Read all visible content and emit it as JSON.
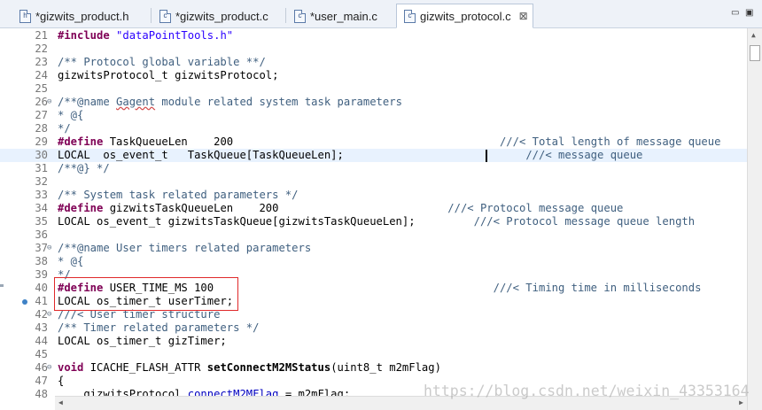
{
  "tabs": [
    {
      "label": "*gizwits_product.h",
      "icon": "h"
    },
    {
      "label": "*gizwits_product.c",
      "icon": "c"
    },
    {
      "label": "*user_main.c",
      "icon": "c"
    },
    {
      "label": "gizwits_protocol.c",
      "icon": "c",
      "close": "⊠"
    }
  ],
  "window_controls": {
    "minimize": "▭",
    "maximize": "▣"
  },
  "editor": {
    "lines": [
      {
        "n": "21",
        "html": "<span class=\"kw\">#include</span> <span class=\"st\">\"dataPointTools.h\"</span>"
      },
      {
        "n": "22",
        "html": ""
      },
      {
        "n": "23",
        "html": "<span class=\"cm\">/** Protocol global variable **/</span>"
      },
      {
        "n": "24",
        "html": "gizwitsProtocol_t gizwitsProtocol;"
      },
      {
        "n": "25",
        "html": ""
      },
      {
        "n": "26",
        "fold": true,
        "html": "<span class=\"cm\">/**@name <span style=\"text-decoration:underline wavy #d34b4b\">Gagent</span> module related system task parameters</span>"
      },
      {
        "n": "27",
        "html": "<span class=\"cm\">* @{</span>"
      },
      {
        "n": "28",
        "html": "<span class=\"cm\">*/</span>"
      },
      {
        "n": "29",
        "html": "<span class=\"kw\">#define</span> TaskQueueLen    200                                         <span class=\"cm\">///&lt; Total length of message queue</span>"
      },
      {
        "n": "30",
        "current": true,
        "html": "LOCAL  os_event_t   TaskQueue[TaskQueueLen];                            <span class=\"cm\">///&lt; message queue</span>"
      },
      {
        "n": "31",
        "html": "<span class=\"cm\">/**@} */</span>"
      },
      {
        "n": "32",
        "html": ""
      },
      {
        "n": "33",
        "html": "<span class=\"cm\">/** System task related parameters */</span>"
      },
      {
        "n": "34",
        "html": "<span class=\"kw\">#define</span> gizwitsTaskQueueLen    200                          <span class=\"cm\">///&lt; Protocol message queue</span>"
      },
      {
        "n": "35",
        "html": "LOCAL os_event_t gizwitsTaskQueue[gizwitsTaskQueueLen];         <span class=\"cm\">///&lt; Protocol message queue length</span>"
      },
      {
        "n": "36",
        "html": ""
      },
      {
        "n": "37",
        "fold": true,
        "html": "<span class=\"cm\">/**@name User timers related parameters</span>"
      },
      {
        "n": "38",
        "html": "<span class=\"cm\">* @{</span>"
      },
      {
        "n": "39",
        "html": "<span class=\"cm\">*/</span>"
      },
      {
        "n": "40",
        "html": "<span class=\"kw\">#define</span> USER_TIME_MS 100                                           <span class=\"cm\">///&lt; Timing time in milliseconds</span>"
      },
      {
        "n": "41",
        "bp": true,
        "html": "LOCAL os_timer_t userTimer;"
      },
      {
        "n": "42",
        "fold": true,
        "html": "<span class=\"cm\">///&lt; User timer structure</span>"
      },
      {
        "n": "43",
        "html": "<span class=\"cm\">/** Timer related parameters */</span>"
      },
      {
        "n": "44",
        "html": "LOCAL os_timer_t gizTimer;"
      },
      {
        "n": "45",
        "html": ""
      },
      {
        "n": "46",
        "fold": true,
        "html": "<span class=\"kw\">void</span> ICACHE_FLASH_ATTR <span class=\"bold\">setConnectM2MStatus</span>(uint8_t m2mFlag)"
      },
      {
        "n": "47",
        "html": "{"
      },
      {
        "n": "48",
        "html": "    gizwitsProtocol.<span style=\"color:#0000c0\">connectM2MFlag</span> = m2mFlag;"
      }
    ]
  },
  "watermark": "https://blog.csdn.net/weixin_43353164"
}
